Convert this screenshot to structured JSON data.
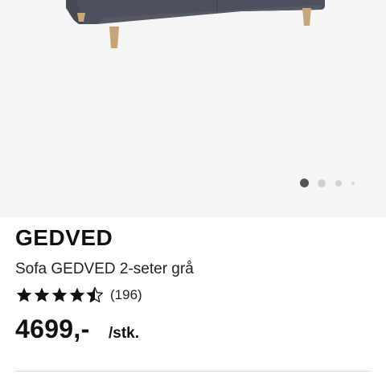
{
  "product": {
    "brand": "GEDVED",
    "description": "Sofa GEDVED 2-seter grå",
    "rating": 4.5,
    "rating_max": 5,
    "review_count": "(196)",
    "price": "4699,-",
    "unit": "/stk."
  },
  "gallery": {
    "image_icon": "sofa-image",
    "slide_count": 4,
    "active_slide": 1
  },
  "colors": {
    "hero_bg": "#f5f5f5",
    "sofa_fabric": "#4b505c",
    "leg_wood": "#c9a77c",
    "dot_active": "#555555",
    "dot_inactive": "#d0d0d0"
  }
}
